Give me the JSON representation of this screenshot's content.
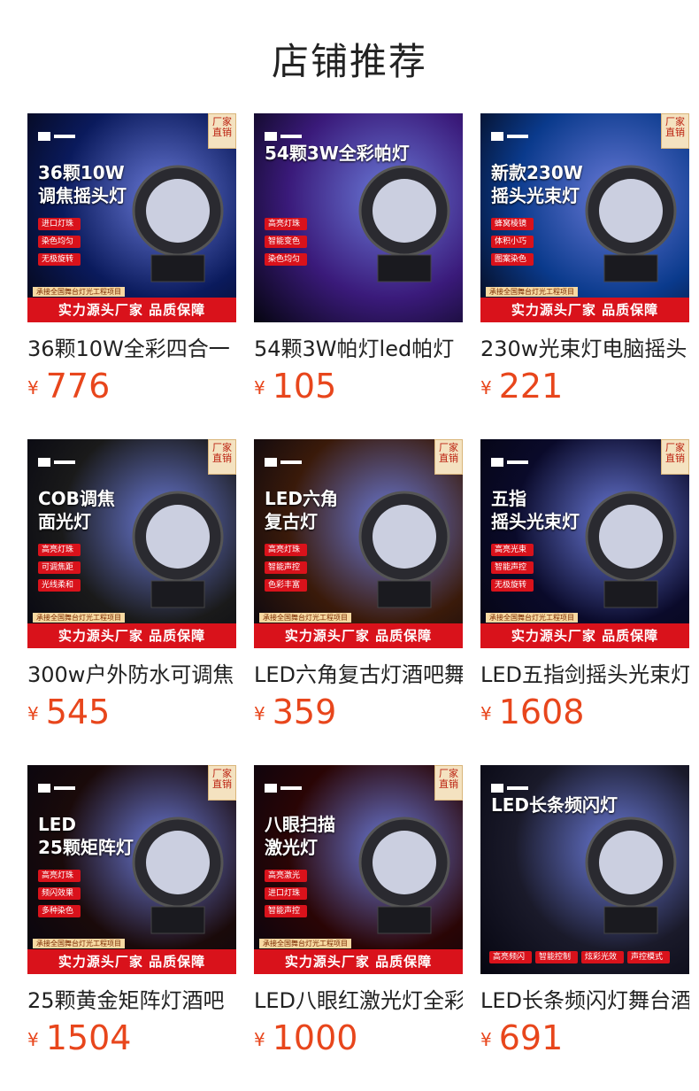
{
  "page": {
    "title": "店铺推荐"
  },
  "currency": "¥",
  "products": [
    {
      "name": "36颗10W全彩四合一",
      "price": "776",
      "headline": "36颗10W\n调焦摇头灯",
      "tags": [
        "进口灯珠",
        "染色均匀",
        "无极旋转"
      ],
      "badge": "厂家直销",
      "strip_small": "承接全国舞台灯光工程项目",
      "strip": "实力源头厂家 品质保障",
      "bg": "#0a1a5c"
    },
    {
      "name": "54颗3W帕灯led帕灯",
      "price": "105",
      "headline": "54颗3W全彩帕灯",
      "tags": [
        "高亮灯珠",
        "智能变色",
        "染色均匀"
      ],
      "badge": "",
      "strip_small": "",
      "strip": "",
      "bg": "#3a1a7a"
    },
    {
      "name": "230w光束灯电脑摇头",
      "price": "221",
      "headline": "新款230W\n摇头光束灯",
      "tags": [
        "蜂窝棱镜",
        "体积小巧",
        "图案染色"
      ],
      "badge": "厂家直销",
      "strip_small": "承接全国舞台灯光工程项目",
      "strip": "实力源头厂家 品质保障",
      "bg": "#0a3a8c"
    },
    {
      "name": "300w户外防水可调焦",
      "price": "545",
      "headline": "COB调焦\n面光灯",
      "tags": [
        "高亮灯珠",
        "可调焦距",
        "光线柔和"
      ],
      "badge": "厂家直销",
      "strip_small": "承接全国舞台灯光工程项目",
      "strip": "实力源头厂家 品质保障",
      "bg": "#1a1a1a"
    },
    {
      "name": "LED六角复古灯酒吧舞台",
      "price": "359",
      "headline": "LED六角\n复古灯",
      "tags": [
        "高亮灯珠",
        "智能声控",
        "色彩丰富"
      ],
      "badge": "厂家直销",
      "strip_small": "承接全国舞台灯光工程项目",
      "strip": "实力源头厂家 品质保障",
      "bg": "#3a1a0a"
    },
    {
      "name": "LED五指剑摇头光束灯",
      "price": "1608",
      "headline": "五指\n摇头光束灯",
      "tags": [
        "高亮光束",
        "智能声控",
        "无极旋转"
      ],
      "badge": "厂家直销",
      "strip_small": "承接全国舞台灯光工程项目",
      "strip": "实力源头厂家 品质保障",
      "bg": "#0a0a2a"
    },
    {
      "name": "25颗黄金矩阵灯酒吧",
      "price": "1504",
      "headline": "LED\n25颗矩阵灯",
      "tags": [
        "高亮灯珠",
        "频闪效果",
        "多种染色"
      ],
      "badge": "厂家直销",
      "strip_small": "承接全国舞台灯光工程项目",
      "strip": "实力源头厂家 品质保障",
      "bg": "#1a0a0a"
    },
    {
      "name": "LED八眼红激光灯全彩",
      "price": "1000",
      "headline": "八眼扫描\n激光灯",
      "tags": [
        "高亮激光",
        "进口灯珠",
        "智能声控"
      ],
      "badge": "厂家直销",
      "strip_small": "承接全国舞台灯光工程项目",
      "strip": "实力源头厂家 品质保障",
      "bg": "#2a0505"
    },
    {
      "name": "LED长条频闪灯舞台酒吧",
      "price": "691",
      "headline": "LED长条频闪灯",
      "tags": [
        "高亮频闪",
        "智能控制",
        "炫彩光效",
        "声控模式"
      ],
      "badge": "",
      "strip_small": "",
      "strip": "",
      "bg": "#1a1a2a"
    }
  ],
  "colors": {
    "price": "#e8461c",
    "strip": "#d9121b"
  }
}
